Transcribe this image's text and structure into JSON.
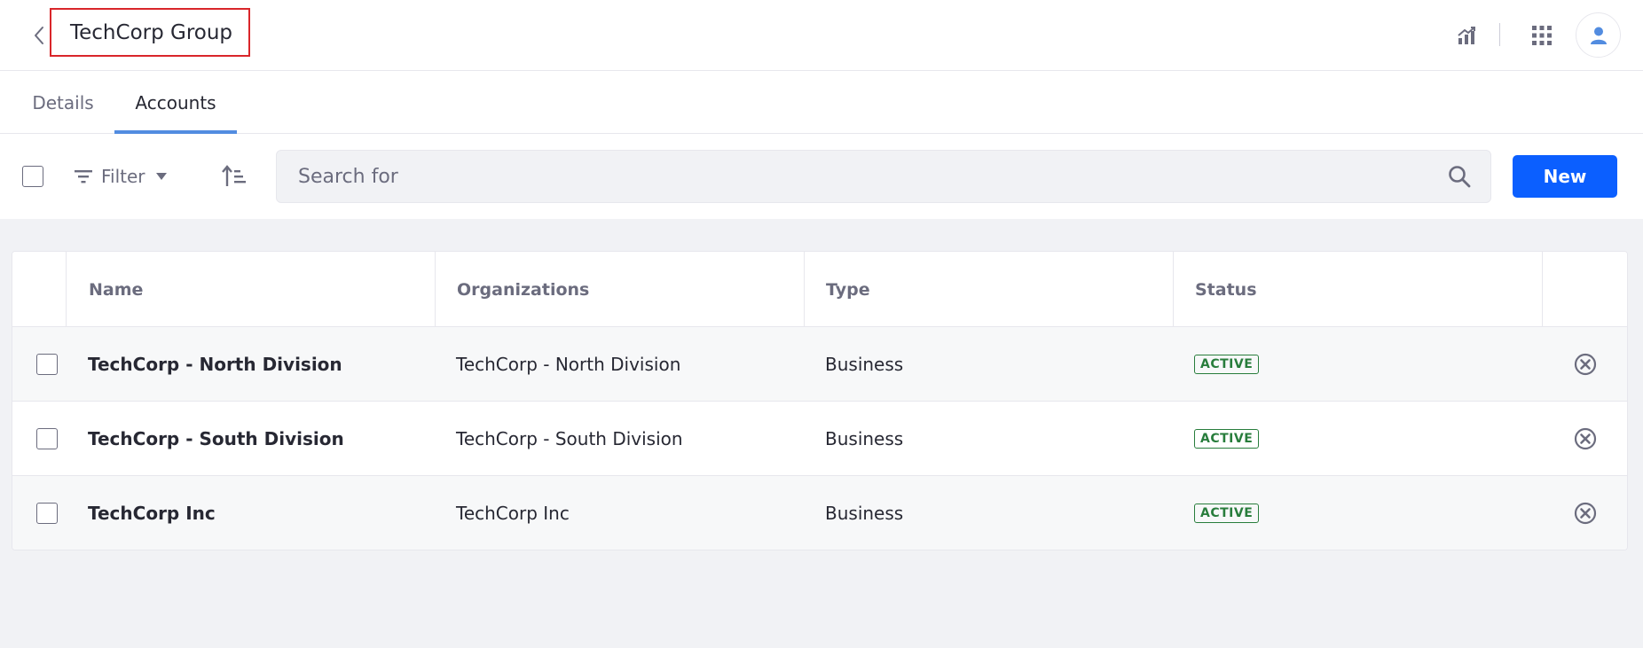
{
  "header": {
    "title": "TechCorp Group",
    "icons": [
      "chevron-left-icon",
      "analytics-icon",
      "apps-grid-icon",
      "user-icon"
    ]
  },
  "tabs": [
    {
      "label": "Details",
      "active": false
    },
    {
      "label": "Accounts",
      "active": true
    }
  ],
  "toolbar": {
    "filter_label": "Filter",
    "search_placeholder": "Search for",
    "search_value": "",
    "new_label": "New"
  },
  "table": {
    "columns": [
      "Name",
      "Organizations",
      "Type",
      "Status"
    ],
    "rows": [
      {
        "name": "TechCorp - North Division",
        "organizations": "TechCorp - North Division",
        "type": "Business",
        "status": "ACTIVE"
      },
      {
        "name": "TechCorp - South Division",
        "organizations": "TechCorp - South Division",
        "type": "Business",
        "status": "ACTIVE"
      },
      {
        "name": "TechCorp Inc",
        "organizations": "TechCorp Inc",
        "type": "Business",
        "status": "ACTIVE"
      }
    ]
  },
  "colors": {
    "primary": "#0b5fff",
    "tab_indicator": "#528ce0",
    "active_status": "#287d3c",
    "title_highlight": "#d9262a",
    "background": "#f1f2f5"
  }
}
